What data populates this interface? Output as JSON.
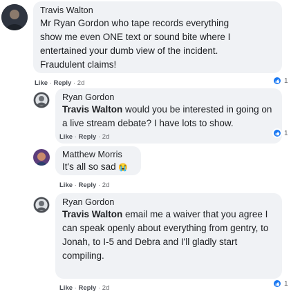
{
  "comments": [
    {
      "author": "Travis Walton",
      "text": "Mr Ryan Gordon who tape records everything show me even ONE text or sound bite where I entertained your dumb view of the incident. Fraudulent claims!",
      "like_label": "Like",
      "reply_label": "Reply",
      "time": "2d",
      "reactions": "1"
    }
  ],
  "replies": [
    {
      "author": "Ryan Gordon",
      "mention": "Travis Walton",
      "text": " would you be interested in going on a live stream debate? I have lots to show.",
      "like_label": "Like",
      "reply_label": "Reply",
      "time": "2d",
      "reactions": "1"
    },
    {
      "author": "Matthew Morris",
      "text": "It's all so sad ",
      "emoji": "😭",
      "like_label": "Like",
      "reply_label": "Reply",
      "time": "2d"
    },
    {
      "author": "Ryan Gordon",
      "mention": "Travis Walton",
      "text": " email me a waiver that you agree I can speak openly about everything from gentry, to Jonah, to I-5 and Debra and I'll gladly start compiling.",
      "like_label": "Like",
      "reply_label": "Reply",
      "time": "2d",
      "reactions": "1"
    }
  ],
  "colors": {
    "bubble": "#f0f2f5",
    "text": "#1c1e21",
    "meta": "#65676b",
    "like": "#1877f2"
  },
  "icons": [
    "thumbs-up-icon"
  ]
}
